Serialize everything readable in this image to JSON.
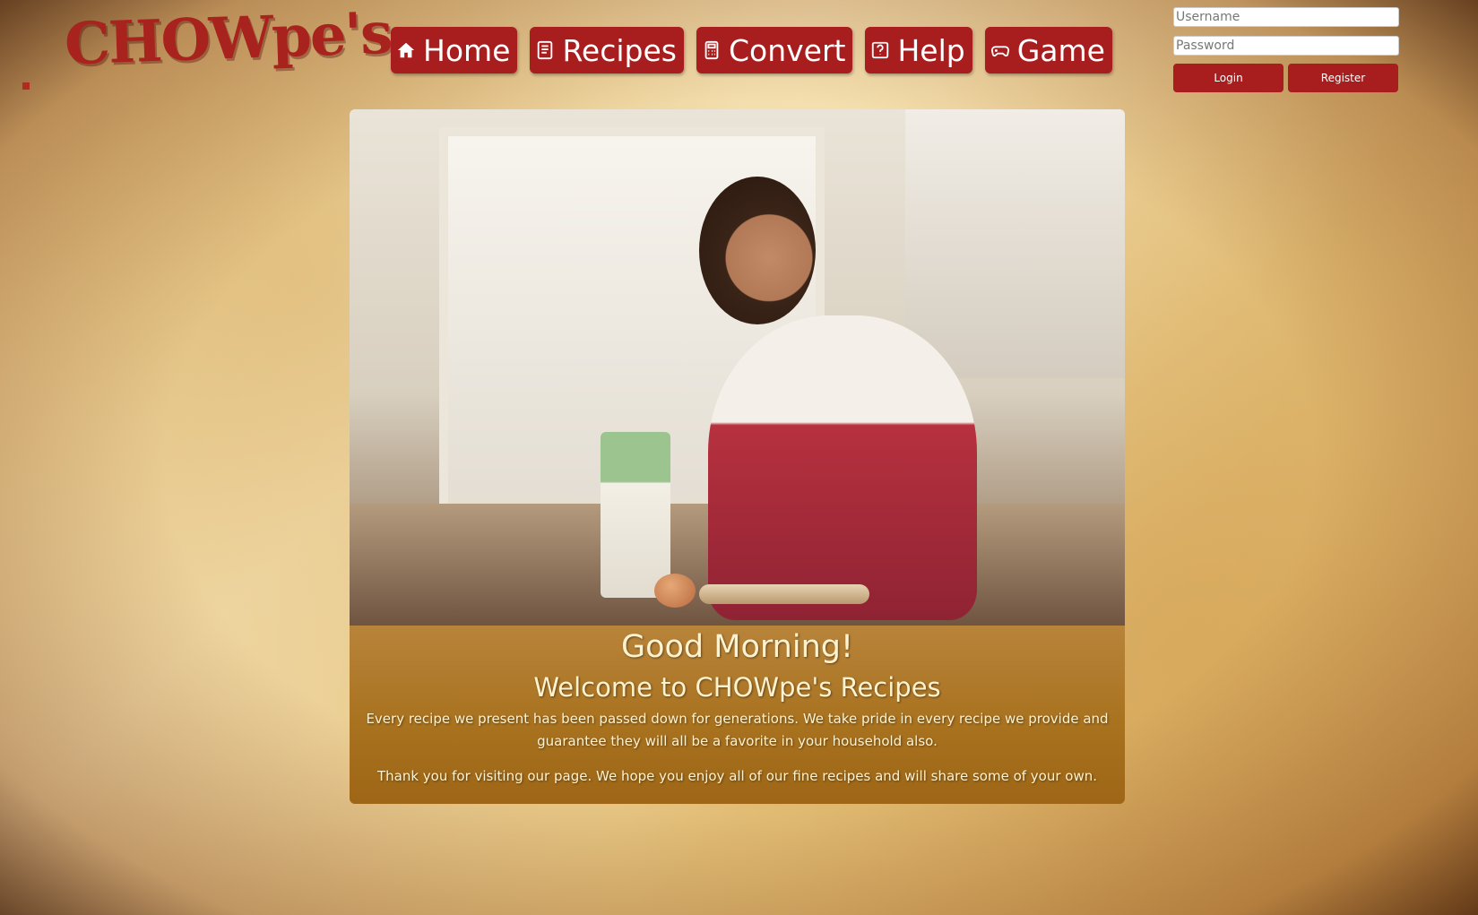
{
  "brand": {
    "logo_text": "CHOWpe's"
  },
  "nav": {
    "items": [
      {
        "label": "Home",
        "icon": "home-icon"
      },
      {
        "label": "Recipes",
        "icon": "recipe-book-icon"
      },
      {
        "label": "Convert",
        "icon": "calculator-icon"
      },
      {
        "label": "Help",
        "icon": "help-icon"
      },
      {
        "label": "Game",
        "icon": "gamepad-icon"
      }
    ]
  },
  "auth": {
    "username_placeholder": "Username",
    "password_placeholder": "Password",
    "login_label": "Login",
    "register_label": "Register"
  },
  "hero": {
    "alt": "woman rolling dough in a kitchen"
  },
  "welcome": {
    "greeting": "Good Morning!",
    "title": "Welcome to CHOWpe's Recipes",
    "paragraph1": "Every recipe we present has been passed down for generations. We take pride in every recipe we provide and guarantee they will all be a favorite in your household also.",
    "paragraph2": "Thank you for visiting our page. We hope you enjoy all of our fine recipes and will share some of your own."
  },
  "colors": {
    "accent": "#a81d1d",
    "panel": "#a8721f",
    "panel_text": "#fff2cf"
  }
}
